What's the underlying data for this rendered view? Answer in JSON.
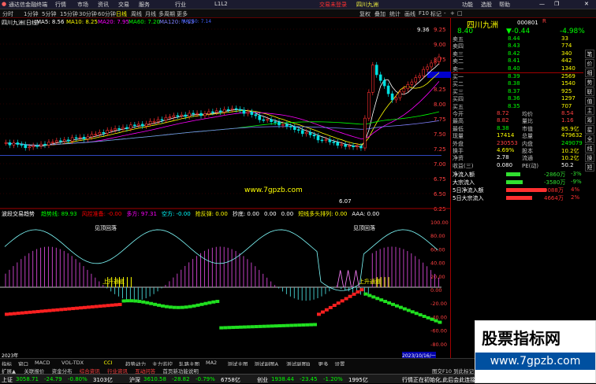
{
  "menu": {
    "app_name": "通达信金融终端",
    "items": [
      "行情",
      "市场",
      "资讯",
      "交易",
      "服务",
      "行业",
      "L1L2"
    ],
    "center_link": "交易未登录",
    "stock_tab": "四川九洲",
    "right_items": [
      "功能",
      "选股",
      "帮助"
    ]
  },
  "toolbar": {
    "periods": [
      "分时",
      "1分钟",
      "5分钟",
      "15分钟",
      "30分钟",
      "60分钟",
      "日线",
      "周线",
      "月线",
      "多周期",
      "更多"
    ],
    "right_tools": [
      "复权",
      "叠加",
      "统计",
      "画线",
      "F10",
      "标记",
      "-",
      "+",
      "□"
    ]
  },
  "chart": {
    "stock_title": "四川九洲(日线)",
    "ma_values": [
      "MA5: 8.56",
      "MA10: 8.25",
      "MA20: 7.95",
      "MA60: 7.20",
      "MA120: 7.13",
      "MA250: 7.14"
    ],
    "ma_colors": [
      "#ffffff",
      "#ffff00",
      "#ff00ff",
      "#00ff00",
      "#8080ff",
      "#4060ff"
    ],
    "high_label": "9.36",
    "low_label": "6.07",
    "price_ticks": [
      "9.25",
      "9.00",
      "8.75",
      "8.50",
      "8.25",
      "8.00",
      "7.75",
      "7.50",
      "7.25",
      "7.00",
      "6.75",
      "6.50",
      "6.25"
    ],
    "current_price_tag": "8.43",
    "watermark": "www.7gpzb.com",
    "indicator_title": "波段交易趋势",
    "indicator_values": [
      {
        "text": "趋势线: 89.93",
        "color": "#00ff00"
      },
      {
        "text": "风控准备: -0.00",
        "color": "#ff0000"
      },
      {
        "text": "多方: 97.31",
        "color": "#ff00ff"
      },
      {
        "text": "空方: -0.00",
        "color": "#00ffff"
      },
      {
        "text": "抢反弹: 0.00",
        "color": "#ffff00"
      },
      {
        "text": "抄底: 0.00",
        "color": "#ffffff"
      },
      {
        "text": "0.00",
        "color": "#ffffff"
      },
      {
        "text": "0.00",
        "color": "#ffffff"
      },
      {
        "text": "短线多头排列: 0.00",
        "color": "#ffff00"
      },
      {
        "text": "AAA: 0.00",
        "color": "#ffffff"
      }
    ],
    "indicator_ticks": [
      "100.00",
      "80.00",
      "60.00",
      "40.00",
      "20.00",
      "0.00",
      "-20.00",
      "-40.00",
      "-60.00",
      "-80.00"
    ],
    "annotations": [
      "见顶回落",
      "见顶回落",
      "上升通道",
      "上升通道"
    ],
    "date_left": "2023年",
    "date_right": "2023/10/16/一",
    "chart_tabs": [
      "指标",
      "窗口",
      "MACD",
      "VOL-TDX",
      "CCI",
      "趋势动力",
      "主力监控",
      "轧路主图",
      "MA2",
      "测试主图",
      "测试副图A",
      "测试副图B",
      "更多",
      "设置"
    ]
  },
  "quote": {
    "name": "四川九洲",
    "code": "000801",
    "badge": "R",
    "price": "8.40",
    "change": "▼-0.44",
    "pct": "-4.98%",
    "asks": [
      {
        "label": "卖五",
        "price": "8.44",
        "vol": "33"
      },
      {
        "label": "卖四",
        "price": "8.43",
        "vol": "774"
      },
      {
        "label": "卖三",
        "price": "8.42",
        "vol": "340"
      },
      {
        "label": "卖二",
        "price": "8.41",
        "vol": "442"
      },
      {
        "label": "卖一",
        "price": "8.40",
        "vol": "1340"
      }
    ],
    "bids": [
      {
        "label": "买一",
        "price": "8.39",
        "vol": "2569"
      },
      {
        "label": "买二",
        "price": "8.38",
        "vol": "1540"
      },
      {
        "label": "买三",
        "price": "8.37",
        "vol": "925"
      },
      {
        "label": "买四",
        "price": "8.36",
        "vol": "1297"
      },
      {
        "label": "买五",
        "price": "8.35",
        "vol": "707"
      }
    ],
    "stats": [
      {
        "l1": "今开",
        "v1": "8.72",
        "l2": "均价",
        "v2": "8.54",
        "c1": "#ff4040",
        "c2": "#ff4040"
      },
      {
        "l1": "最高",
        "v1": "8.82",
        "l2": "量比",
        "v2": "1.16",
        "c1": "#ff4040",
        "c2": "#ff4040"
      },
      {
        "l1": "最低",
        "v1": "8.38",
        "l2": "市值",
        "v2": "85.9亿",
        "c1": "#00ff00",
        "c2": "#ffff00"
      },
      {
        "l1": "现量",
        "v1": "17414",
        "l2": "总量",
        "v2": "479632",
        "c1": "#ffff00",
        "c2": "#ffff00"
      },
      {
        "l1": "外盘",
        "v1": "230553",
        "l2": "内盘",
        "v2": "249079",
        "c1": "#ff4040",
        "c2": "#00ff00"
      },
      {
        "l1": "换手",
        "v1": "4.69%",
        "l2": "股本",
        "v2": "10.2亿",
        "c1": "#ffff00",
        "c2": "#ffff00"
      },
      {
        "l1": "净资",
        "v1": "2.78",
        "l2": "流通",
        "v2": "10.2亿",
        "c1": "#ffffff",
        "c2": "#ffff00"
      },
      {
        "l1": "收益(三)",
        "v1": "0.080",
        "l2": "PE(动)",
        "v2": "50.2",
        "c1": "#ffffff",
        "c2": "#ffffff"
      }
    ],
    "flows": [
      {
        "label": "净流入额",
        "value": "-2860万",
        "pct": "-3%",
        "bar": "green",
        "level": 0.3
      },
      {
        "label": "大宗流入",
        "value": "-3580万",
        "pct": "-9%",
        "bar": "green",
        "level": 0.35
      },
      {
        "label": "5日净流入额",
        "value": "9088万",
        "pct": "4%",
        "bar": "red",
        "level": 0.85
      },
      {
        "label": "5日大宗流入",
        "value": "4664万",
        "pct": "2%",
        "bar": "red",
        "level": 0.55
      }
    ],
    "side_tabs": [
      "笔",
      "价",
      "细",
      "势",
      "联",
      "值",
      "主",
      "筹",
      "星",
      "全",
      "线",
      "操",
      "短"
    ]
  },
  "bottom": {
    "tabs": [
      "扩展▲",
      "关联报价",
      "资金分布",
      "综合资讯",
      "行业资讯",
      "互动问答",
      "首页新功能说明"
    ],
    "indices": [
      {
        "name": "上证",
        "value": "3058.71",
        "chg": "-24.79",
        "pct": "-0.80%",
        "amt": "3103亿"
      },
      {
        "name": "沪深",
        "value": "3610.58",
        "chg": "-28.82",
        "pct": "-0.79%",
        "amt": "6758亿"
      },
      {
        "name": "创业",
        "value": "1938.44",
        "chg": "-23.45",
        "pct": "-1.20%",
        "amt": "1995亿"
      }
    ],
    "status_msg": "行情正在初始化,此后会此连接",
    "hint": "图交F10 到此标记"
  },
  "watermark_box": {
    "title": "股票指标网",
    "url": "www.7gpzb.com"
  }
}
